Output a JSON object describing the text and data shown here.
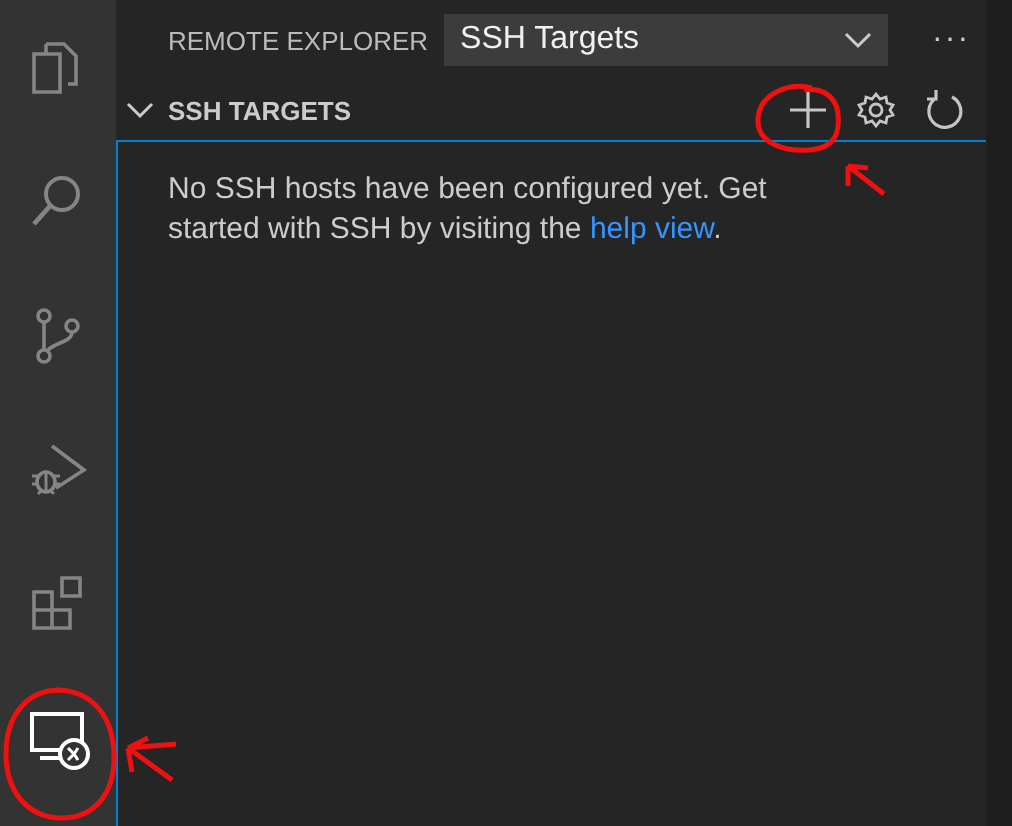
{
  "activity_bar": [
    {
      "kind": "files",
      "selected": false
    },
    {
      "kind": "search",
      "selected": false
    },
    {
      "kind": "source-control",
      "selected": false
    },
    {
      "kind": "run-debug",
      "selected": false
    },
    {
      "kind": "extensions",
      "selected": false
    },
    {
      "kind": "remote",
      "selected": true
    }
  ],
  "sidebar": {
    "title": "REMOTE EXPLORER",
    "dropdown": {
      "value": "SSH Targets"
    },
    "more": "···",
    "section": {
      "title": "SSH TARGETS",
      "expanded": true,
      "message": {
        "text": "No SSH hosts have been configured yet. Get started with SSH by visiting the ",
        "link": "help view",
        "after": "."
      }
    }
  }
}
